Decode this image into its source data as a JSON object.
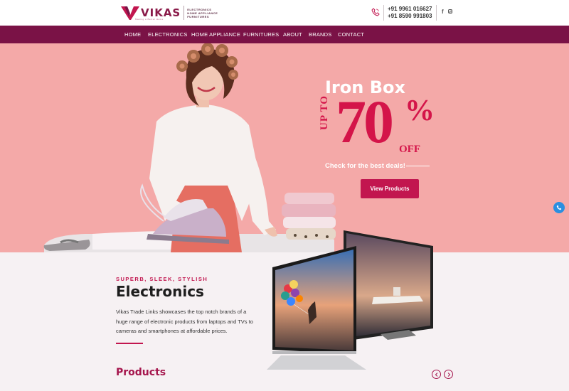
{
  "header": {
    "logo_text": "VIKAS",
    "logo_tagline": "Making a Better Home",
    "logo_categories": [
      "ELECTRONICS",
      "HOME APPLIANCE",
      "FURNITURES"
    ],
    "phones": [
      "+91 9961 016627",
      "+91 8590 991803"
    ],
    "social_icons": [
      "facebook-icon",
      "instagram-icon"
    ]
  },
  "nav": {
    "items": [
      "HOME",
      "ELECTRONICS",
      "HOME APPLIANCE",
      "FURNITURES",
      "ABOUT",
      "BRANDS",
      "CONTACT"
    ]
  },
  "hero": {
    "title": "Iron Box",
    "upto": "UP TO",
    "percent": "70",
    "percent_sign": "%",
    "off": "OFF",
    "subtitle": "Check for the best deals!",
    "cta_label": "View Products"
  },
  "electronics": {
    "tagline": "SUPERB, SLEEK, STYLISH",
    "title": "Electronics",
    "body": "Vikas Trade Links showcases the top notch brands of a huge range of electronic products from laptops and TVs to cameras and smartphones at affordable prices."
  },
  "products": {
    "title": "Products"
  },
  "colors": {
    "brand": "#7a1246",
    "accent": "#c2164f",
    "hero_bg": "#f4a9a8"
  }
}
